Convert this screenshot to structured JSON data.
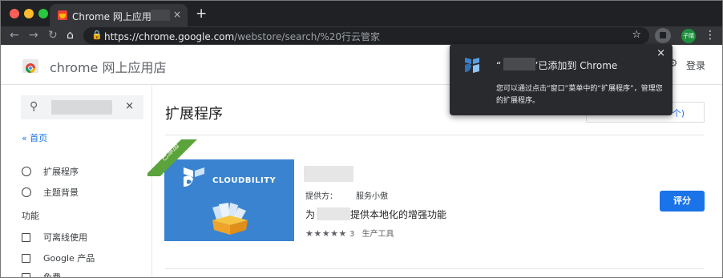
{
  "browser": {
    "tab_title": "Chrome 网上应用店 -",
    "tab_close": "×",
    "new_tab": "+",
    "url_host": "https://chrome.google.com",
    "url_path": "/webstore/search/%20行云管家",
    "profile_label": "子晴"
  },
  "store": {
    "title": "chrome 网上应用店",
    "signin": "登录"
  },
  "sidebar": {
    "search_placeholder": "",
    "clear": "×",
    "home": "« 首页",
    "types": [
      "扩展程序",
      "主题背景"
    ],
    "features_heading": "功能",
    "features": [
      "可离线使用",
      "Google 产品",
      "免费"
    ]
  },
  "main": {
    "heading": "扩展程序",
    "sort_label": "个)",
    "item": {
      "badge": "已添加",
      "thumb_brand": "CLOUDBILITY",
      "provider_label": "提供方：",
      "provider_name": "服务小傲",
      "desc_prefix": "为",
      "desc_main": "提供本地化的增强功能",
      "stars": "★★★★★",
      "rating_count": "3",
      "category": "生产工具",
      "rate_button": "评分"
    }
  },
  "popup": {
    "title_open": "“",
    "title_close": "”已添加到 Chrome",
    "body": "您可以通过点击“窗口”菜单中的“扩展程序”，管理您的扩展程序。",
    "close": "×"
  },
  "colors": {
    "accent": "#1a73e8",
    "chrome_dark": "#202124",
    "badge_green": "#5ba33b",
    "thumb_blue": "#3a83d0"
  },
  "icons": [
    "chrome-store-icon",
    "back-icon",
    "forward-icon",
    "reload-icon",
    "home-icon",
    "lock-icon",
    "star-icon",
    "extension-icon",
    "menu-icon",
    "search-icon",
    "close-icon",
    "settings-icon",
    "cloudbility-icon"
  ]
}
